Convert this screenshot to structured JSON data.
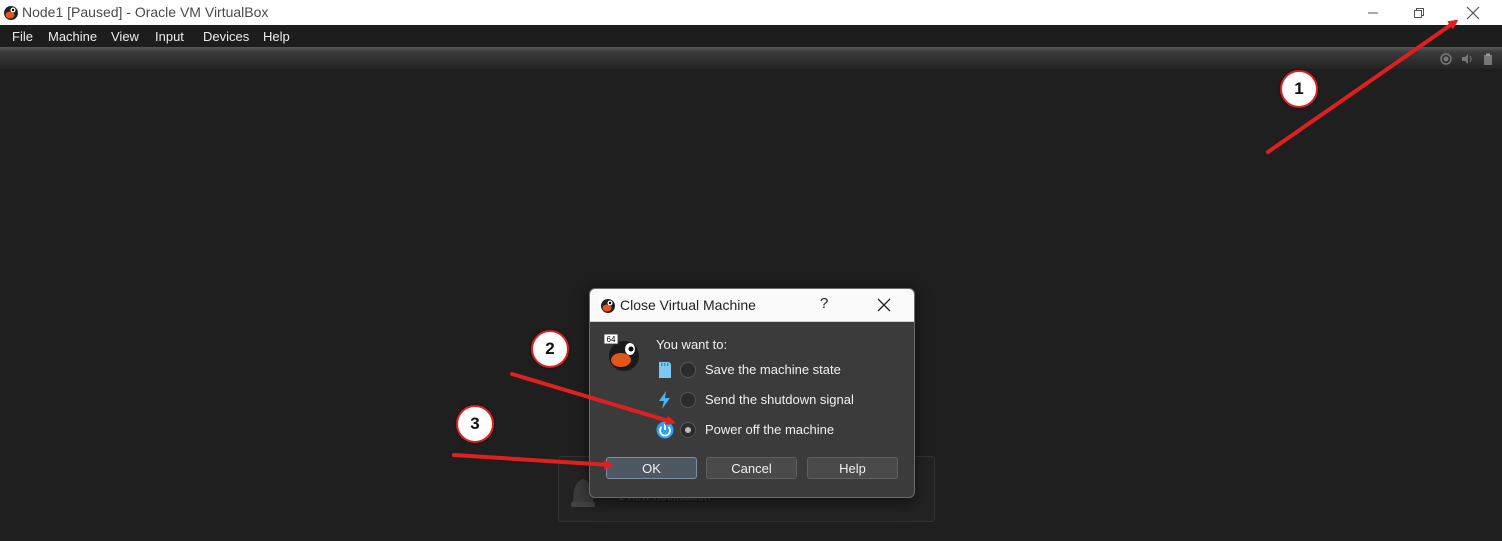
{
  "window": {
    "title": "Node1 [Paused] - Oracle VM VirtualBox",
    "controls": [
      "minimize-icon",
      "restore-icon",
      "close-icon"
    ]
  },
  "menu": {
    "items": [
      "File",
      "Machine",
      "View",
      "Input",
      "Devices",
      "Help"
    ]
  },
  "status_icons": [
    "recording-icon",
    "audio-icon",
    "clipboard-icon"
  ],
  "notification": {
    "text": "1 new notification"
  },
  "dialog": {
    "title": "Close Virtual Machine",
    "help_glyph": "?",
    "prompt": "You want to:",
    "os_badge": "64",
    "options": [
      {
        "label": "Save the machine state",
        "icon": "sd-card-icon",
        "selected": false
      },
      {
        "label": "Send the shutdown signal",
        "icon": "lightning-icon",
        "selected": false
      },
      {
        "label": "Power off the machine",
        "icon": "power-icon",
        "selected": true
      }
    ],
    "buttons": {
      "ok": "OK",
      "cancel": "Cancel",
      "help": "Help"
    }
  },
  "annotations": {
    "step1": "1",
    "step2": "2",
    "step3": "3",
    "color": "#e02020"
  }
}
